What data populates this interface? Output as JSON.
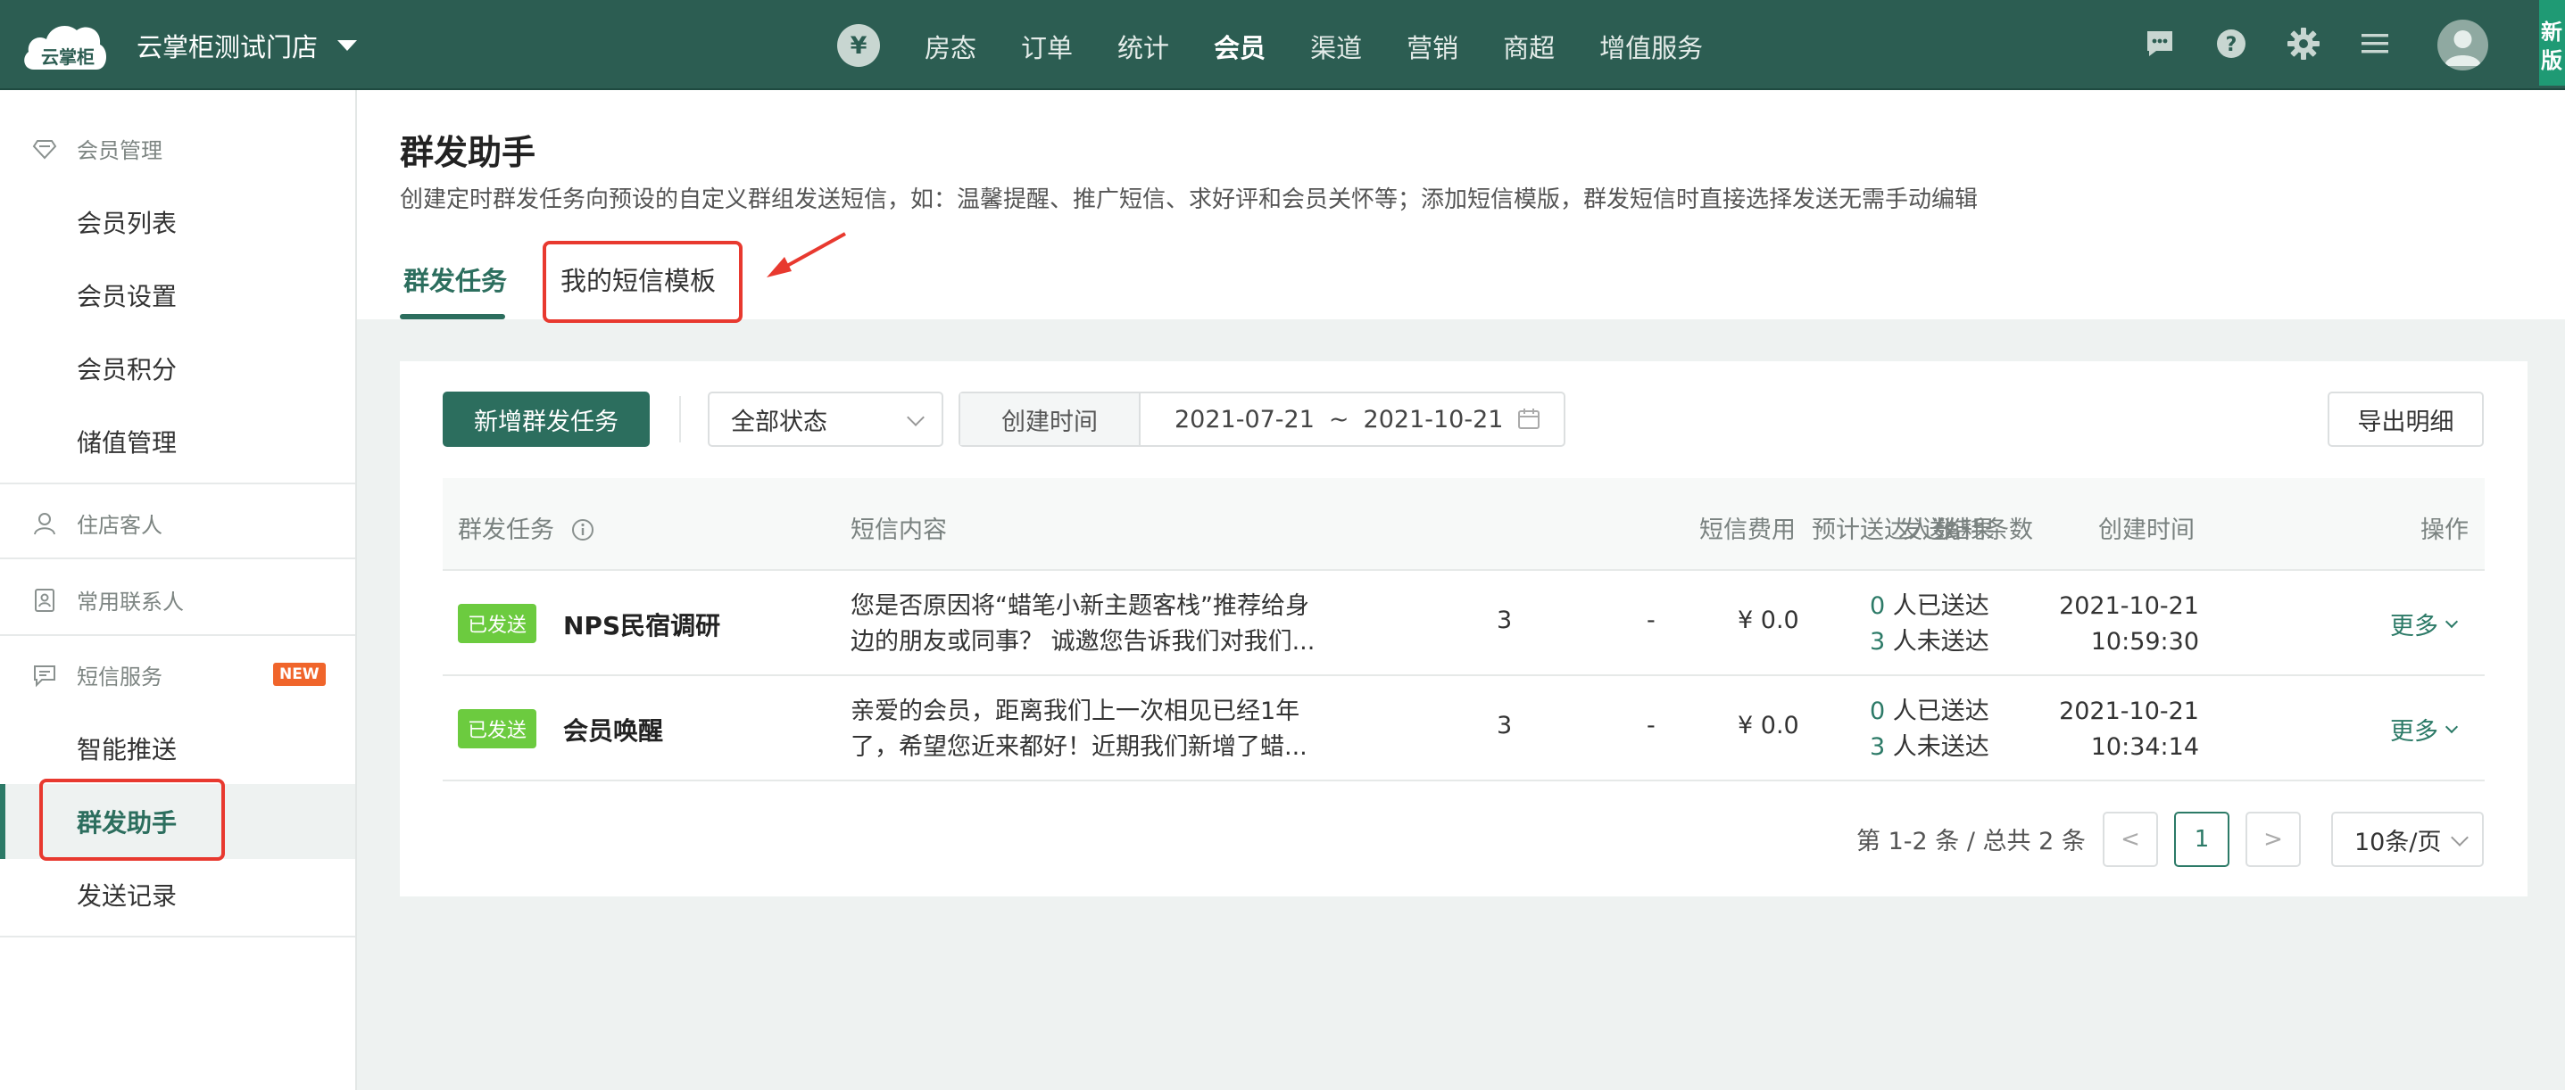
{
  "topbar": {
    "logo_text": "云掌柜",
    "store_name": "云掌柜测试门店",
    "yen_symbol": "¥",
    "nav": [
      "房态",
      "订单",
      "统计",
      "会员",
      "渠道",
      "营销",
      "商超",
      "增值服务"
    ],
    "nav_active": "会员",
    "new_tag": "新版",
    "icons": [
      "message-icon",
      "help-icon",
      "gear-icon",
      "menu-icon",
      "avatar-icon"
    ]
  },
  "sidebar": {
    "group1": "会员管理",
    "group1_items": [
      "会员列表",
      "会员设置",
      "会员积分",
      "储值管理"
    ],
    "group2": "住店客人",
    "group3": "常用联系人",
    "group4": "短信服务",
    "new_badge": "NEW",
    "group4_items": [
      "智能推送",
      "群发助手",
      "发送记录"
    ],
    "active_item": "群发助手"
  },
  "page": {
    "title": "群发助手",
    "description": "创建定时群发任务向预设的自定义群组发送短信，如：温馨提醒、推广短信、求好评和会员关怀等；添加短信模版，群发短信时直接选择发送无需手动编辑",
    "tabs": [
      "群发任务",
      "我的短信模板"
    ],
    "active_tab": "群发任务"
  },
  "toolbar": {
    "add_button": "新增群发任务",
    "status_select": "全部状态",
    "date_label": "创建时间",
    "date_start": "2021-07-21",
    "date_sep": "~",
    "date_end": "2021-10-21",
    "export_button": "导出明细"
  },
  "table": {
    "headers": [
      "群发任务",
      "短信内容",
      "预计送达人数",
      "消耗条数",
      "短信费用",
      "发送结果",
      "创建时间",
      "操作"
    ],
    "rows": [
      {
        "status": "已发送",
        "name": "NPS民宿调研",
        "content_line1": "您是否原因将“蜡笔小新主题客栈”推荐给身",
        "content_line2": "边的朋友或同事？ 诚邀您告诉我们对我们...",
        "expected": "3",
        "consumed": "-",
        "cost": "¥ 0.0",
        "sent_count": "0",
        "sent_label": "人已送达",
        "unsent_count": "3",
        "unsent_label": "人未送达",
        "date": "2021-10-21",
        "time": "10:59:30",
        "action": "更多"
      },
      {
        "status": "已发送",
        "name": "会员唤醒",
        "content_line1": "亲爱的会员，距离我们上一次相见已经1年",
        "content_line2": "了，希望您近来都好！近期我们新增了蜡...",
        "expected": "3",
        "consumed": "-",
        "cost": "¥ 0.0",
        "sent_count": "0",
        "sent_label": "人已送达",
        "unsent_count": "3",
        "unsent_label": "人未送达",
        "date": "2021-10-21",
        "time": "10:34:14",
        "action": "更多"
      }
    ]
  },
  "pagination": {
    "info": "第 1-2 条 / 总共 2 条",
    "prev": "<",
    "current": "1",
    "next": ">",
    "page_size": "10条/页"
  },
  "colors": {
    "brand": "#2c5d52",
    "accent": "#2c6e5e",
    "sent_badge": "#6ccb3f",
    "new_badge": "#f0652b",
    "highlight": "#e8392f"
  }
}
